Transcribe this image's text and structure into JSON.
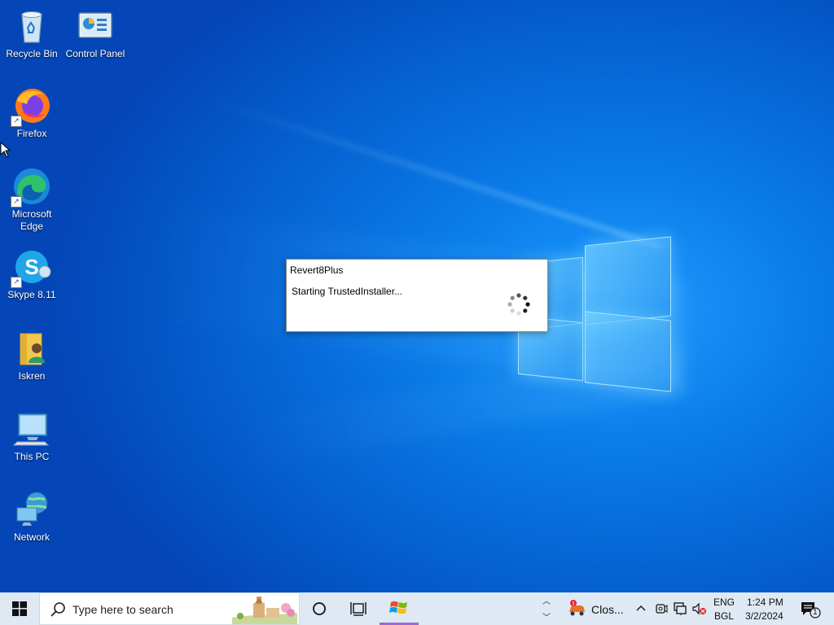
{
  "desktop": {
    "icons": [
      {
        "label": "Recycle Bin"
      },
      {
        "label": "Control Panel"
      },
      {
        "label": "Firefox"
      },
      {
        "label": "Microsoft Edge"
      },
      {
        "label": "Skype 8.11"
      },
      {
        "label": "Iskren"
      },
      {
        "label": "This PC"
      },
      {
        "label": "Network"
      }
    ]
  },
  "dialog": {
    "title": "Revert8Plus",
    "message": "Starting TrustedInstaller..."
  },
  "taskbar": {
    "search_placeholder": "Type here to search",
    "notification_app_label": "Clos...",
    "language_top": "ENG",
    "language_bottom": "BGL",
    "time": "1:24 PM",
    "date": "3/2/2024",
    "notification_count": "1"
  },
  "colors": {
    "taskbar_bg": "#dfe9f4",
    "active_indicator": "#9b6ad6",
    "desktop_blue": "#0a7be8"
  }
}
